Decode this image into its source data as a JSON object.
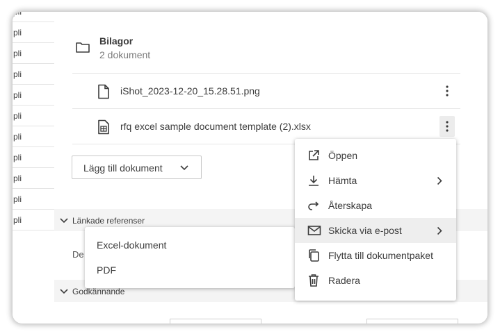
{
  "left_list": {
    "row_label": "pli",
    "rows": [
      "pli",
      "pli",
      "pli",
      "pli",
      "pli",
      "pli",
      "pli",
      "pli",
      "pli",
      "pli"
    ]
  },
  "folder": {
    "title": "Bilagor",
    "subtitle": "2 dokument"
  },
  "documents": [
    {
      "name": "iShot_2023-12-20_15.28.51.png",
      "icon": "file-icon"
    },
    {
      "name": "rfq excel sample document template (2).xlsx",
      "icon": "spreadsheet-file-icon"
    }
  ],
  "add_document_label": "Lägg till dokument",
  "sections": {
    "linked_refs": "Länkade referenser",
    "approval": "Godkännande"
  },
  "linked_refs_text": "De",
  "context_menu": {
    "items": [
      {
        "label": "Öppen",
        "icon": "open-external-icon"
      },
      {
        "label": "Hämta",
        "icon": "download-icon"
      },
      {
        "label": "Återskapa",
        "icon": "regenerate-icon"
      },
      {
        "label": "Skicka via e-post",
        "icon": "email-icon"
      },
      {
        "label": "Flytta till dokumentpaket",
        "icon": "copy-icon"
      },
      {
        "label": "Radera",
        "icon": "trash-icon"
      }
    ],
    "highlighted_item": "Skicka via e-post"
  },
  "email_submenu": {
    "items": [
      "Excel-dokument",
      "PDF"
    ]
  },
  "colors": {
    "text": "#3c3c3c",
    "muted": "#7a7a7a",
    "highlight": "#eeeeee",
    "section_bg": "#f4f4f4"
  }
}
